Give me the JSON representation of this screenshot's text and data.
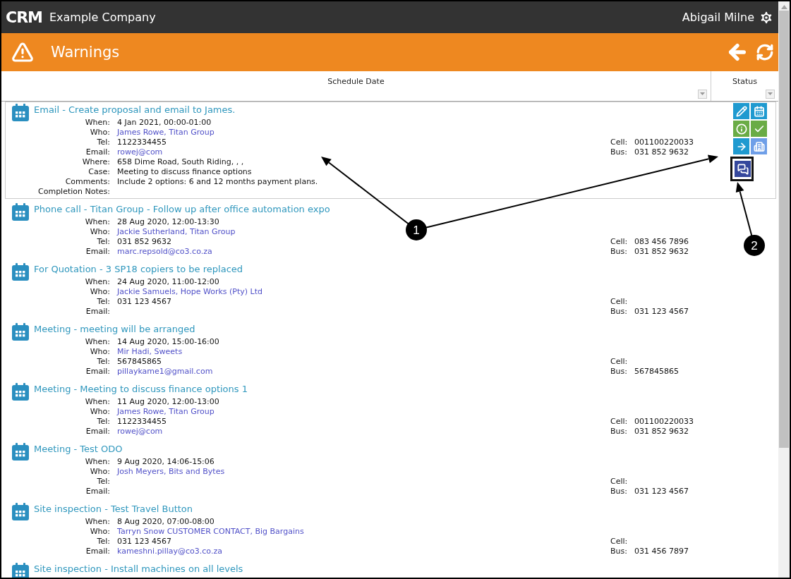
{
  "app": {
    "logo": "CRM",
    "company": "Example Company",
    "user": "Abigail Milne"
  },
  "page": {
    "title": "Warnings"
  },
  "columns": [
    {
      "label": "Schedule Date"
    },
    {
      "label": "Status"
    }
  ],
  "activities": [
    {
      "title": "Email - Create proposal and email to James.",
      "expanded": true,
      "fields": [
        {
          "label": "When:",
          "value": "4 Jan 2021, 00:00-01:00",
          "kind": "text"
        },
        {
          "label": "Who:",
          "value": "James Rowe, Titan Group",
          "kind": "link"
        },
        {
          "label": "Tel:",
          "value": "1122334455",
          "kind": "text"
        },
        {
          "label": "Email:",
          "value": "rowej@com",
          "kind": "link"
        },
        {
          "label": "Where:",
          "value": "658 Dime Road, South Riding, , ,",
          "kind": "text"
        },
        {
          "label": "Case:",
          "value": "Meeting to discuss finance options",
          "kind": "text"
        },
        {
          "label": "Comments:",
          "value": "Include 2 options: 6 and 12 months payment plans.",
          "kind": "text"
        },
        {
          "label": "Completion Notes:",
          "kind": "text"
        }
      ],
      "contact": [
        {
          "label": "Cell:",
          "value": "001100220033"
        },
        {
          "label": "Bus:",
          "value": "031 852 9632"
        }
      ],
      "actions": [
        {
          "kind": "edit",
          "highlighted": false
        },
        {
          "kind": "schedule",
          "highlighted": false
        },
        {
          "kind": "info",
          "highlighted": false
        },
        {
          "kind": "complete",
          "highlighted": false
        },
        {
          "kind": "forward",
          "highlighted": false
        },
        {
          "kind": "company",
          "highlighted": false
        },
        {
          "kind": "notes",
          "highlighted": true
        }
      ]
    },
    {
      "title": "Phone call - Titan Group - Follow up after office automation expo",
      "expanded": false,
      "fields": [
        {
          "label": "When:",
          "value": "28 Aug 2020, 12:00-13:30",
          "kind": "text"
        },
        {
          "label": "Who:",
          "value": "Jackie Sutherland, Titan Group",
          "kind": "link"
        },
        {
          "label": "Tel:",
          "value": "031 852 9632",
          "kind": "text"
        },
        {
          "label": "Email:",
          "value": "marc.repsold@co3.co.za",
          "kind": "link"
        }
      ],
      "contact": [
        {
          "label": "Cell:",
          "value": "083 456 7896"
        },
        {
          "label": "Bus:",
          "value": "031 852 9632"
        }
      ]
    },
    {
      "title": "For Quotation - 3 SP18 copiers to be replaced",
      "expanded": false,
      "fields": [
        {
          "label": "When:",
          "value": "24 Aug 2020, 11:00-12:00",
          "kind": "text"
        },
        {
          "label": "Who:",
          "value": "Jackie Samuels, Hope Works (Pty) Ltd",
          "kind": "link"
        },
        {
          "label": "Tel:",
          "value": "031 123 4567",
          "kind": "text"
        },
        {
          "label": "Email:",
          "kind": "link"
        }
      ],
      "contact": [
        {
          "label": "Cell:"
        },
        {
          "label": "Bus:",
          "value": "031 123 4567"
        }
      ]
    },
    {
      "title": "Meeting - meeting will be arranged",
      "expanded": false,
      "fields": [
        {
          "label": "When:",
          "value": "14 Aug 2020, 15:00-16:00",
          "kind": "text"
        },
        {
          "label": "Who:",
          "value": "Mir Hadi, Sweets",
          "kind": "link"
        },
        {
          "label": "Tel:",
          "value": "567845865",
          "kind": "text"
        },
        {
          "label": "Email:",
          "value": "pillaykame1@gmail.com",
          "kind": "link"
        }
      ],
      "contact": [
        {
          "label": "Cell:"
        },
        {
          "label": "Bus:",
          "value": "567845865"
        }
      ]
    },
    {
      "title": "Meeting - Meeting to discuss finance options 1",
      "expanded": false,
      "fields": [
        {
          "label": "When:",
          "value": "11 Aug 2020, 12:00-13:00",
          "kind": "text"
        },
        {
          "label": "Who:",
          "value": "James Rowe, Titan Group",
          "kind": "link"
        },
        {
          "label": "Tel:",
          "value": "1122334455",
          "kind": "text"
        },
        {
          "label": "Email:",
          "value": "rowej@com",
          "kind": "link"
        }
      ],
      "contact": [
        {
          "label": "Cell:",
          "value": "001100220033"
        },
        {
          "label": "Bus:",
          "value": "031 852 9632"
        }
      ]
    },
    {
      "title": "Meeting - Test ODO",
      "expanded": false,
      "fields": [
        {
          "label": "When:",
          "value": "9 Aug 2020, 14:06-15:06",
          "kind": "text"
        },
        {
          "label": "Who:",
          "value": "Josh Meyers, Bits and Bytes",
          "kind": "link"
        },
        {
          "label": "Tel:",
          "kind": "text"
        },
        {
          "label": "Email:",
          "kind": "link"
        }
      ],
      "contact": [
        {
          "label": "Cell:"
        },
        {
          "label": "Bus:",
          "value": "031 123 4567"
        }
      ]
    },
    {
      "title": "Site inspection - Test Travel Button",
      "expanded": false,
      "fields": [
        {
          "label": "When:",
          "value": "8 Aug 2020, 07:00-08:00",
          "kind": "text"
        },
        {
          "label": "Who:",
          "value": "Tarryn Snow CUSTOMER CONTACT, Big Bargains",
          "kind": "link"
        },
        {
          "label": "Tel:",
          "value": "031 123 4567",
          "kind": "text"
        },
        {
          "label": "Email:",
          "value": "kameshni.pillay@co3.co.za",
          "kind": "link"
        }
      ],
      "contact": [
        {
          "label": "Cell:"
        },
        {
          "label": "Bus:",
          "value": "031 456 7897"
        }
      ]
    },
    {
      "title": "Site inspection - Install machines on all levels",
      "expanded": false
    }
  ],
  "callouts": [
    {
      "label": "1"
    },
    {
      "label": "2"
    }
  ]
}
